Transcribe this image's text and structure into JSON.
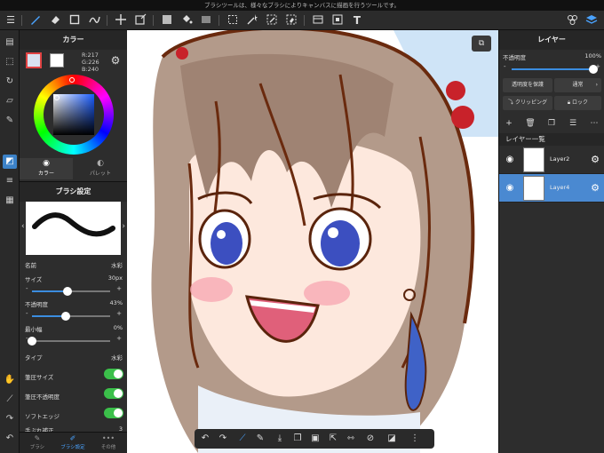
{
  "status_bar": {
    "text": "ブラシツールは、様々なブラシによりキャンバスに描画を行うツールです。"
  },
  "toolbar": {
    "tools": [
      "brush-icon",
      "eraser-icon",
      "rectangle-icon",
      "paint-brush-icon",
      "move-icon",
      "transform-icon",
      "fill-color-icon",
      "bucket-icon",
      "gradient-icon",
      "select-rect-icon",
      "magic-wand-icon",
      "select-pen-icon",
      "select-eraser-icon",
      "panel-icon",
      "text-select-icon",
      "text-icon"
    ],
    "text_tool_label": "T"
  },
  "color_panel": {
    "title": "カラー",
    "r_label": "R:217",
    "g_label": "G:226",
    "b_label": "B:240",
    "fg_color": "#d9e2f0",
    "tab_color_label": "カラー",
    "tab_palette_label": "パレット"
  },
  "brush_panel": {
    "title": "ブラシ設定",
    "name_label": "名前",
    "name_value": "水彩",
    "size_label": "サイズ",
    "size_value": "30px",
    "size_level": 0.45,
    "opacity_label": "不透明度",
    "opacity_value": "43%",
    "opacity_level": 0.43,
    "min_width_label": "最小幅",
    "min_width_value": "0%",
    "min_width_level": 0.0,
    "type_label": "タイプ",
    "type_value": "水彩",
    "pressure_size_label": "筆圧サイズ",
    "pressure_opacity_label": "筆圧不透明度",
    "soft_edge_label": "ソフトエッジ",
    "smoothing_label": "手ぶれ補正",
    "smoothing_value": "3"
  },
  "bottom_tabs": [
    {
      "label": "ブラシ"
    },
    {
      "label": "ブラシ設定"
    },
    {
      "label": "その他"
    }
  ],
  "layer_panel": {
    "title": "レイヤー",
    "opacity_label": "不透明度",
    "opacity_value": "100%",
    "opacity_level": 1.0,
    "protect_alpha_label": "透明度を保護",
    "blend_mode_label": "通常",
    "clipping_label": "クリッピング",
    "lock_label": "ロック",
    "list_header": "レイヤー一覧",
    "layers": [
      {
        "name": "Layer2",
        "selected": false
      },
      {
        "name": "Layer4",
        "selected": true
      }
    ]
  },
  "accent_color": "#4a89d1"
}
